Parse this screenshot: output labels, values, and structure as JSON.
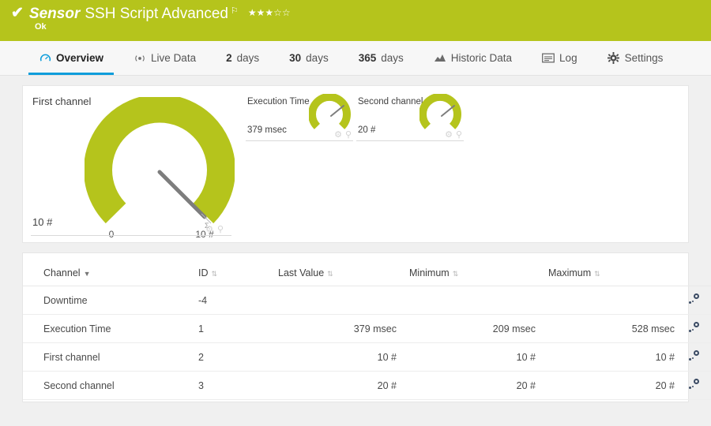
{
  "header": {
    "status_icon": "check-icon",
    "sensor_kind": "Sensor",
    "title": "SSH Script Advanced",
    "flag_icon": "flag-icon",
    "stars": "★★★☆☆",
    "status_text": "Ok",
    "color": "#b5c41c"
  },
  "tabs": [
    {
      "label": "Overview",
      "icon": "gauge-icon",
      "active": true
    },
    {
      "label": "Live Data",
      "icon": "live-signal-icon",
      "active": false
    },
    {
      "num": "2",
      "label": "days",
      "icon": "",
      "active": false
    },
    {
      "num": "30",
      "label": "days",
      "icon": "",
      "active": false
    },
    {
      "num": "365",
      "label": "days",
      "icon": "",
      "active": false
    },
    {
      "label": "Historic Data",
      "icon": "area-chart-icon",
      "active": false
    },
    {
      "label": "Log",
      "icon": "list-icon",
      "active": false
    },
    {
      "label": "Settings",
      "icon": "gear-icon",
      "active": false
    }
  ],
  "gauges": {
    "primary": {
      "label": "First channel",
      "value": "10 #",
      "scale_min": "0",
      "scale_max": "10 #",
      "percent": 100,
      "arc_color": "#b5c41c"
    },
    "small": [
      {
        "label": "Execution Time",
        "value": "379 msec",
        "percent": 72,
        "arc_color": "#b5c41c"
      },
      {
        "label": "Second channel",
        "value": "20 #",
        "percent": 72,
        "arc_color": "#b5c41c"
      }
    ]
  },
  "table": {
    "headers": {
      "channel": "Channel",
      "id": "ID",
      "last_value": "Last Value",
      "minimum": "Minimum",
      "maximum": "Maximum"
    },
    "sort_indicator": "▼",
    "sort_neutral": "⇅",
    "rows": [
      {
        "channel": "Downtime",
        "id": "-4",
        "last_value": "",
        "minimum": "",
        "maximum": ""
      },
      {
        "channel": "Execution Time",
        "id": "1",
        "last_value": "379 msec",
        "minimum": "209 msec",
        "maximum": "528 msec"
      },
      {
        "channel": "First channel",
        "id": "2",
        "last_value": "10 #",
        "minimum": "10 #",
        "maximum": "10 #"
      },
      {
        "channel": "Second channel",
        "id": "3",
        "last_value": "20 #",
        "minimum": "20 #",
        "maximum": "20 #"
      }
    ],
    "action_icon": "channel-settings-icon"
  },
  "icons": {
    "gear": "⚙",
    "pin": "⚲",
    "needle_mark": "Σ"
  }
}
